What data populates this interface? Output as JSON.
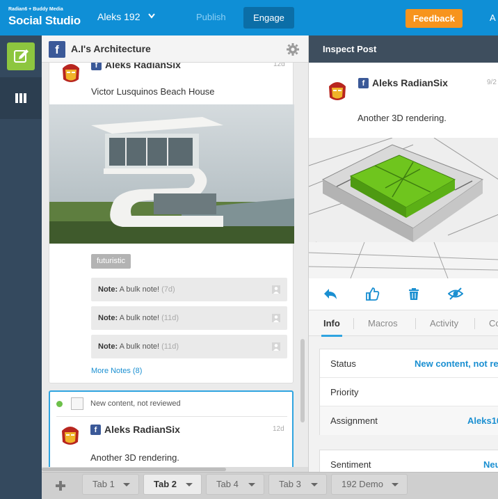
{
  "brand": {
    "line1": "Radian6 + Buddy Media",
    "line2": "Social Studio"
  },
  "topnav": {
    "account": "Aleks 192",
    "publish": "Publish",
    "engage": "Engage",
    "feedback": "Feedback",
    "right_label": "A"
  },
  "column": {
    "title": "A.I's Architecture",
    "post1": {
      "author": "Aleks RadianSix",
      "age": "12d",
      "text": "Victor Lusquinos Beach House",
      "tag": "futuristic",
      "notes": [
        {
          "label": "Note:",
          "text": "A bulk note!",
          "age": "(7d)"
        },
        {
          "label": "Note:",
          "text": "A bulk note!",
          "age": "(11d)"
        },
        {
          "label": "Note:",
          "text": "A bulk note!",
          "age": "(11d)"
        }
      ],
      "more_notes": "More Notes (8)"
    },
    "post2": {
      "status": "New content, not reviewed",
      "author": "Aleks RadianSix",
      "age": "12d",
      "text": "Another 3D rendering."
    }
  },
  "inspect": {
    "title": "Inspect Post",
    "author": "Aleks RadianSix",
    "date": "9/2",
    "text": "Another 3D rendering.",
    "tabs": [
      "Info",
      "Macros",
      "Activity",
      "Co"
    ],
    "rows": [
      {
        "label": "Status",
        "value": "New content, not re"
      },
      {
        "label": "Priority",
        "value": ""
      },
      {
        "label": "Assignment",
        "value": "Aleks10"
      }
    ],
    "sentiment": {
      "label": "Sentiment",
      "value": "Neu"
    }
  },
  "bottom_tabs": [
    "Tab 1",
    "Tab 2",
    "Tab 4",
    "Tab 3",
    "192 Demo"
  ],
  "colors": {
    "topbar": "#0f8fd6",
    "sidebar": "#34495e",
    "compose": "#8dc63f",
    "feedback": "#f7941d",
    "accent": "#2fa4e0",
    "facebook": "#3b5998"
  }
}
